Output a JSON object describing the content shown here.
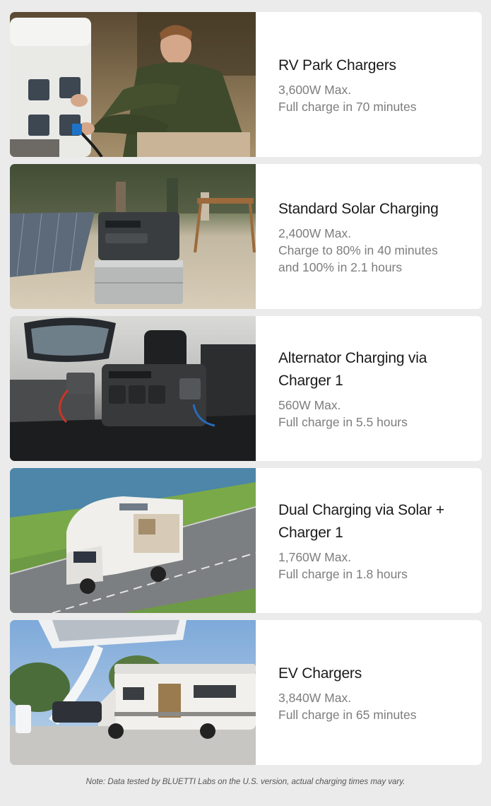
{
  "cards": [
    {
      "title": "RV Park Chargers",
      "lines": [
        "3,600W Max.",
        "Full charge in 70 minutes"
      ],
      "image": "man-plugging-into-rv-park-pedestal"
    },
    {
      "title": "Standard Solar Charging",
      "lines": [
        "2,400W Max.",
        "Charge to 80% in 40 minutes",
        "and 100% in 2.1 hours"
      ],
      "image": "power-station-with-solar-panels-campsite"
    },
    {
      "title": "Alternator Charging via Charger 1",
      "lines": [
        "560W Max.",
        "Full charge in 5.5 hours"
      ],
      "image": "power-station-in-car-trunk"
    },
    {
      "title": "Dual Charging via Solar + Charger 1",
      "lines": [
        "1,760W Max.",
        "Full charge in 1.8 hours"
      ],
      "image": "rv-driving-coastal-road"
    },
    {
      "title": "EV Chargers",
      "lines": [
        "3,840W Max.",
        "Full charge in 65 minutes"
      ],
      "image": "rv-at-ev-charging-station"
    }
  ],
  "note": "Note: Data tested by BLUETTI Labs on the U.S. version, actual charging times may vary.",
  "colors": {
    "background": "#ebebeb",
    "card": "#ffffff",
    "title": "#1a1a1a",
    "body": "#7d7d7d"
  }
}
